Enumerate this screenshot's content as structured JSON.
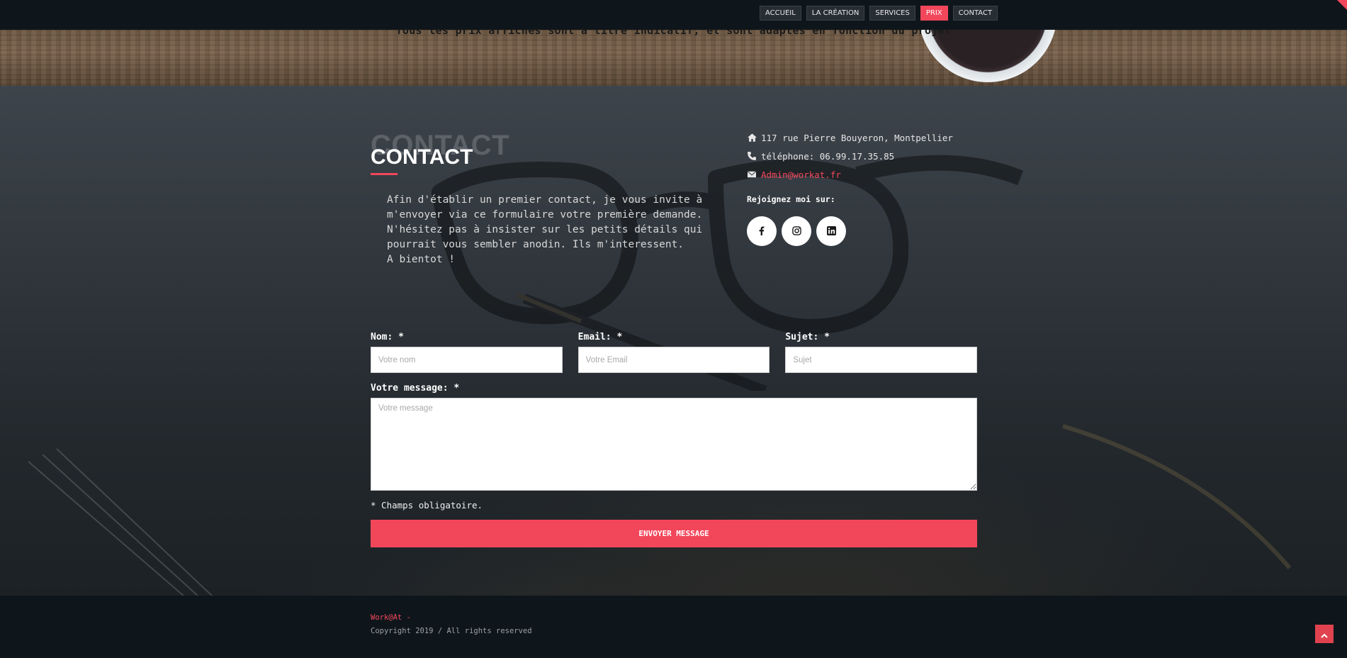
{
  "nav": {
    "items": [
      {
        "label": "ACCUEIL",
        "active": false
      },
      {
        "label": "LA CRÉATION",
        "active": false
      },
      {
        "label": "SERVICES",
        "active": false
      },
      {
        "label": "PRIX",
        "active": true
      },
      {
        "label": "CONTACT",
        "active": false
      }
    ]
  },
  "hero": {
    "text": "Tous les prix affichés sont à titre indicatif, et sont adaptés en fonction du projet"
  },
  "contact": {
    "ghost_title": "CONTACT",
    "title": "CONTACT",
    "intro": "Afin d'établir un premier contact, je vous invite à\nm'envoyer via ce formulaire votre première demande.\nN'hésitez pas à insister sur les petits détails qui\npourrait vous sembler anodin. Ils m'interessent.\nA bientot !",
    "address": "117 rue Pierre Bouyeron, Montpellier",
    "phone": "téléphone: 06.99.17.35.85",
    "email": "Admin@workat.fr",
    "join_label": "Rejoignez moi sur:",
    "socials": [
      {
        "icon": "facebook-icon"
      },
      {
        "icon": "instagram-icon"
      },
      {
        "icon": "linkedin-icon"
      }
    ]
  },
  "form": {
    "name_label": "Nom: *",
    "name_placeholder": "Votre nom",
    "name_value": "",
    "email_label": "Email: *",
    "email_placeholder": "Votre Email",
    "email_value": "",
    "subject_label": "Sujet: *",
    "subject_placeholder": "Sujet",
    "subject_value": "",
    "message_label": "Votre message: *",
    "message_placeholder": "Votre message",
    "message_value": "",
    "required_note": "* Champs obligatoire.",
    "submit_label": "ENVOYER MESSAGE"
  },
  "footer": {
    "brand": "Work@At -",
    "copyright": "Copyright 2019 / All rights reserved"
  },
  "colors": {
    "accent": "#f2475b",
    "topbar": "#0f161b",
    "footer": "#0f161b"
  }
}
